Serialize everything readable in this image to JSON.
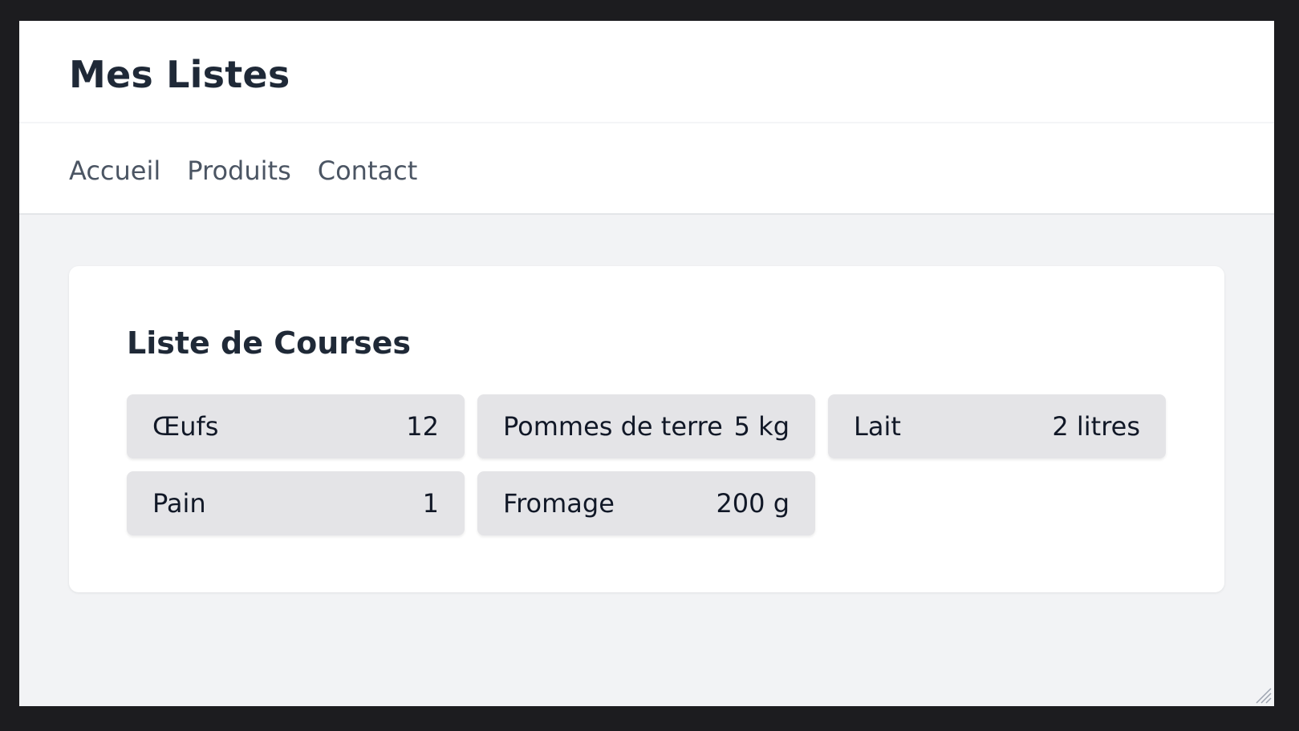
{
  "header": {
    "title": "Mes Listes"
  },
  "nav": {
    "items": [
      "Accueil",
      "Produits",
      "Contact"
    ]
  },
  "list": {
    "title": "Liste de Courses",
    "items": [
      {
        "name": "Œufs",
        "quantity": "12"
      },
      {
        "name": "Pommes de terre",
        "quantity": "5 kg"
      },
      {
        "name": "Lait",
        "quantity": "2 litres"
      },
      {
        "name": "Pain",
        "quantity": "1"
      },
      {
        "name": "Fromage",
        "quantity": "200 g"
      }
    ]
  }
}
